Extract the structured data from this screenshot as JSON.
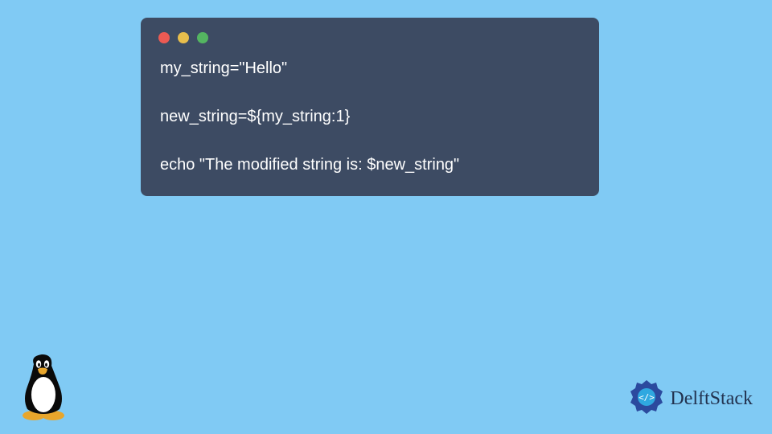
{
  "window": {
    "traffic_lights": {
      "red": "#ec5a53",
      "yellow": "#e8be4c",
      "green": "#54b561"
    },
    "background": "#3d4b63"
  },
  "code": {
    "line1": "my_string=\"Hello\"",
    "line2": "",
    "line3": "new_string=${my_string:1}",
    "line4": "",
    "line5": "echo \"The modified string is: $new_string\""
  },
  "brand": {
    "name": "DelftStack"
  },
  "icons": {
    "tux": "linux-tux-icon",
    "brand_logo": "delftstack-logo-icon"
  }
}
